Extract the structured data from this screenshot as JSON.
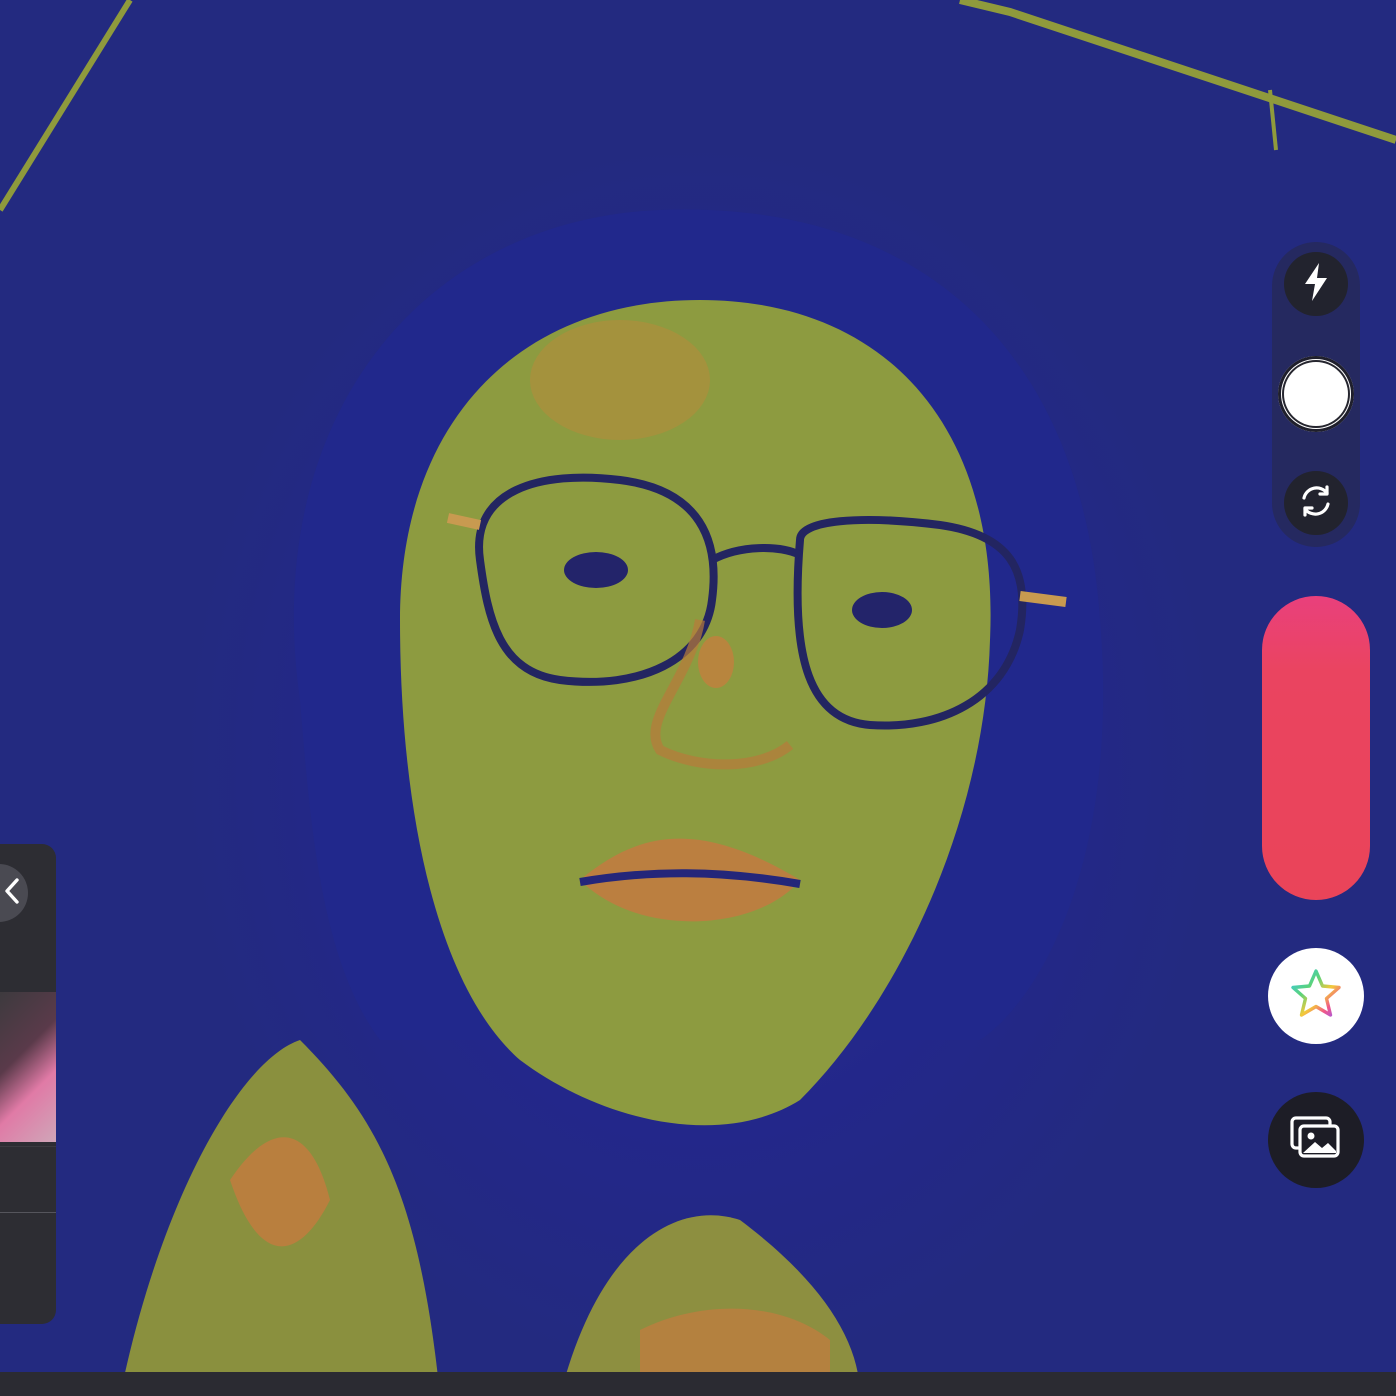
{
  "viewfinder": {
    "description_icon": "camera-preview"
  },
  "controls": {
    "flash_icon": "flash-icon",
    "mode_icon": "circle-mode-icon",
    "flip_icon": "flip-camera-icon",
    "record_color": "#ea4459",
    "effects_icon": "effects-star-icon",
    "gallery_icon": "gallery-icon"
  },
  "side_panel": {
    "collapse_icon": "chevron-left-icon"
  },
  "colors": {
    "rail_bg": "#282846",
    "button_dark": "#22232e",
    "record_top": "#e9407c",
    "record_bottom": "#ea4459",
    "panel_bg": "#2d2d33"
  }
}
